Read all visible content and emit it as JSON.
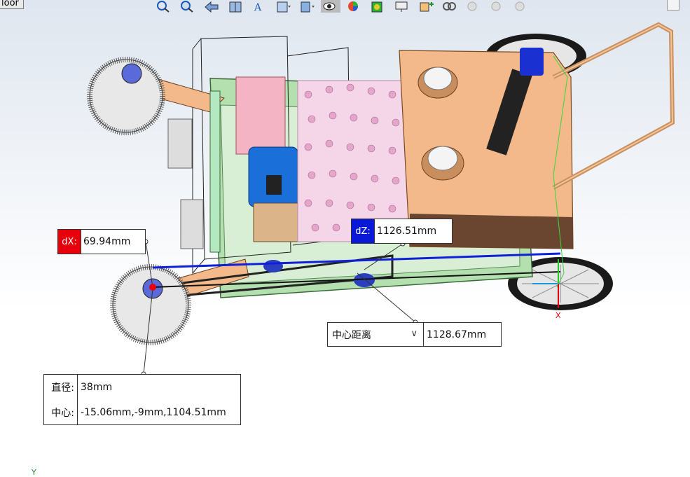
{
  "window": {
    "tab_label": "loor"
  },
  "toolbar": {
    "icons": [
      "zoom-to-fit-icon",
      "zoom-area-icon",
      "previous-view-icon",
      "section-view-icon",
      "dynamic-annotation-icon",
      "view-orientation-icon",
      "display-style-icon",
      "hide-show-items-icon",
      "edit-appearance-icon",
      "apply-scene-icon",
      "view-settings-icon",
      "add-component-icon",
      "mate-icon",
      "info-icon"
    ]
  },
  "measure": {
    "dx": {
      "tag": "dX:",
      "value": "69.94mm",
      "color": "#e8000c"
    },
    "dz": {
      "tag": "dZ:",
      "value": "1126.51mm",
      "color": "#0a19d8"
    },
    "distance": {
      "mode": "中心距离",
      "value": "1128.67mm"
    },
    "circle": {
      "diameter_label": "直径:",
      "diameter_value": "38mm",
      "center_label": "中心:",
      "center_value": "-15.06mm,-9mm,1104.51mm"
    }
  },
  "triad": {
    "x_label": "X",
    "y_label": "Y"
  }
}
